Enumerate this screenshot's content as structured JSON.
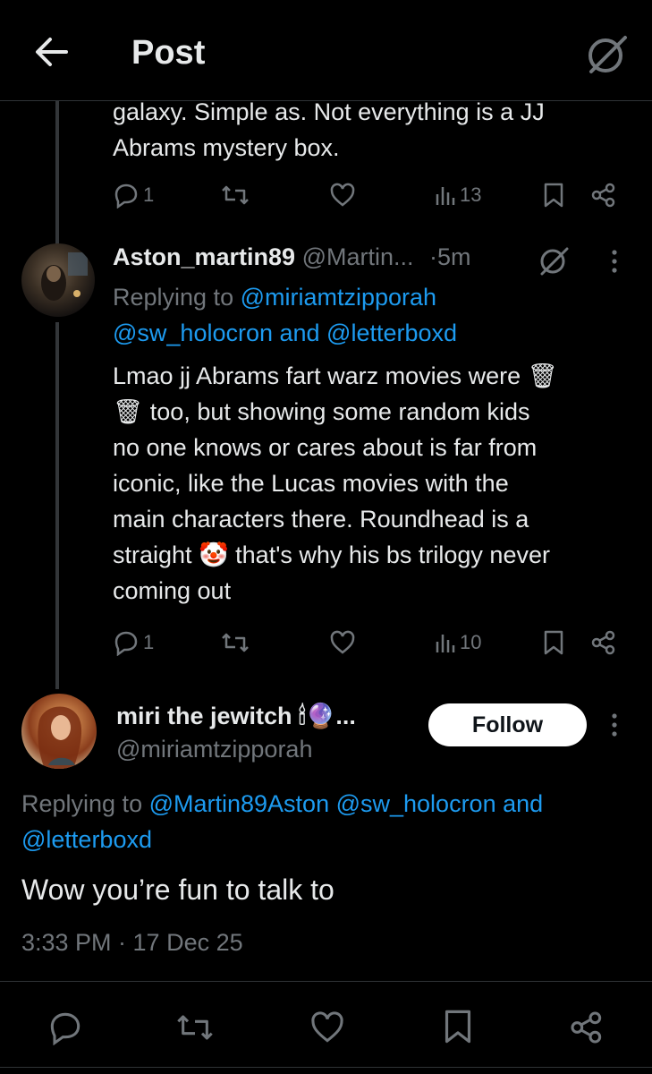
{
  "header": {
    "title": "Post"
  },
  "prev_tweet": {
    "text_line1": "galaxy. Simple as. Not everything is a JJ",
    "text_line2": "Abrams mystery box.",
    "replies": "1",
    "views": "13"
  },
  "reply_tweet": {
    "display_name": "Aston_martin89",
    "handle": "@Martin...",
    "time": "·5m",
    "replying_prefix": "Replying to ",
    "replying_handle1": "@miriamtzipporah",
    "replying_line2": "@sw_holocron and @letterboxd",
    "lines": [
      "Lmao jj Abrams fart warz movies were 🗑",
      "🗑 too, but showing some random kids",
      "no one knows or cares about is far from",
      "iconic, like the Lucas movies with the",
      "main characters there. Roundhead is a",
      "straight 🤡 that's why his bs trilogy never",
      "coming out"
    ],
    "replies": "1",
    "views": "10"
  },
  "main_tweet": {
    "display_name": "miri the jewitch 🕯🔮...",
    "handle": "@miriamtzipporah",
    "follow_label": "Follow",
    "replying_prefix": "Replying to ",
    "replying_line1_links": "@Martin89Aston @sw_holocron and",
    "replying_line2": "@letterboxd",
    "text": "Wow you’re fun to talk to",
    "timestamp": "3:33 PM · 17 Dec 25"
  },
  "colors": {
    "background": "#000000",
    "link": "#1d9bf0",
    "muted": "#71767b",
    "text": "#e7e9ea"
  },
  "icons": [
    "back-arrow-icon",
    "grok-icon",
    "reply-icon",
    "retweet-icon",
    "like-icon",
    "views-icon",
    "bookmark-icon",
    "share-icon",
    "more-icon"
  ]
}
